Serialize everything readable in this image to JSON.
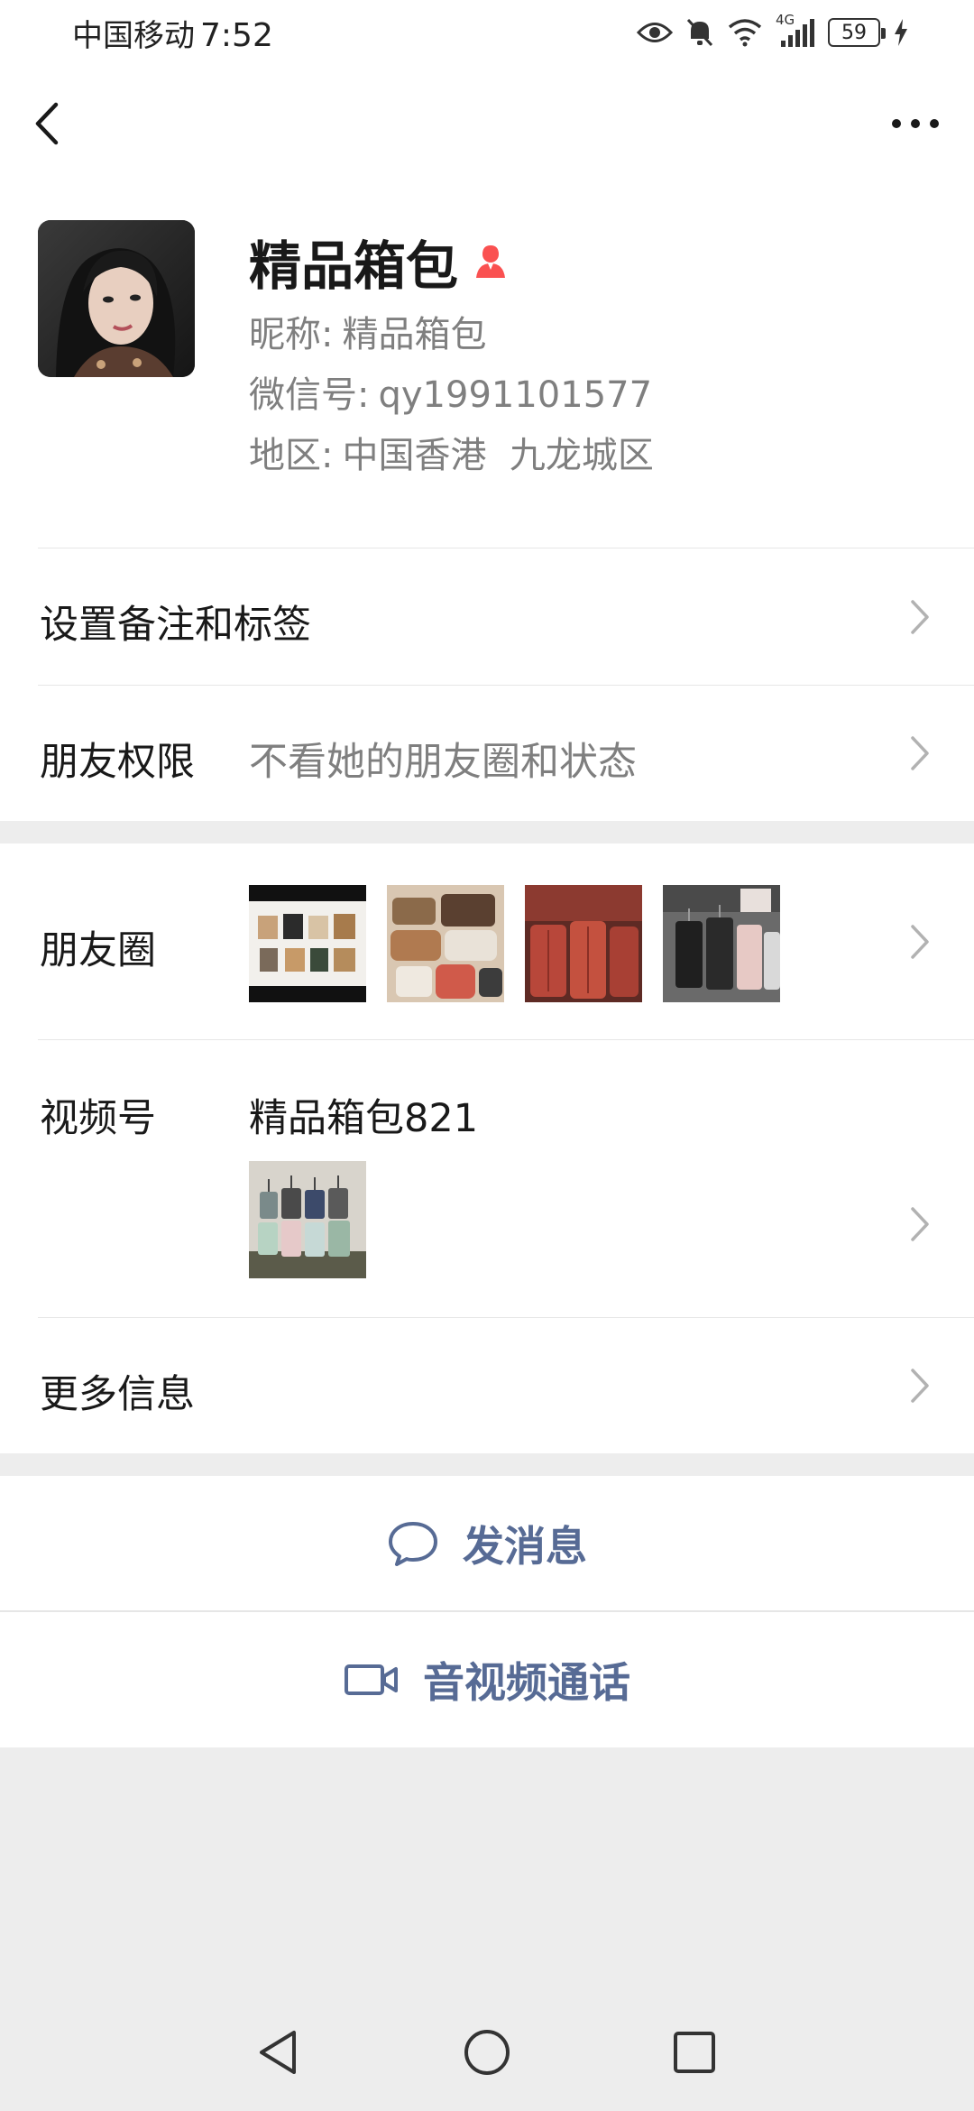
{
  "status": {
    "carrier": "中国移动",
    "time": "7:52",
    "network": "4G",
    "battery": "59"
  },
  "profile": {
    "name": "精品箱包",
    "nickname_label": "昵称:",
    "nickname": "精品箱包",
    "wechat_id_label": "微信号:",
    "wechat_id": "qy1991101577",
    "region_label": "地区:",
    "region": "中国香港  九龙城区",
    "gender_icon": "female-icon",
    "gender_color": "#fa5151"
  },
  "cells": {
    "remark": {
      "title": "设置备注和标签"
    },
    "permission": {
      "title": "朋友权限",
      "value": "不看她的朋友圈和状态"
    },
    "moments": {
      "title": "朋友圈"
    },
    "channels": {
      "title": "视频号",
      "value": "精品箱包821"
    },
    "more": {
      "title": "更多信息"
    }
  },
  "actions": {
    "message": {
      "label": "发消息",
      "icon": "chat-bubble-icon"
    },
    "call": {
      "label": "音视频通话",
      "icon": "video-camera-icon"
    }
  },
  "colors": {
    "link": "#576b95",
    "background": "#ededed"
  }
}
